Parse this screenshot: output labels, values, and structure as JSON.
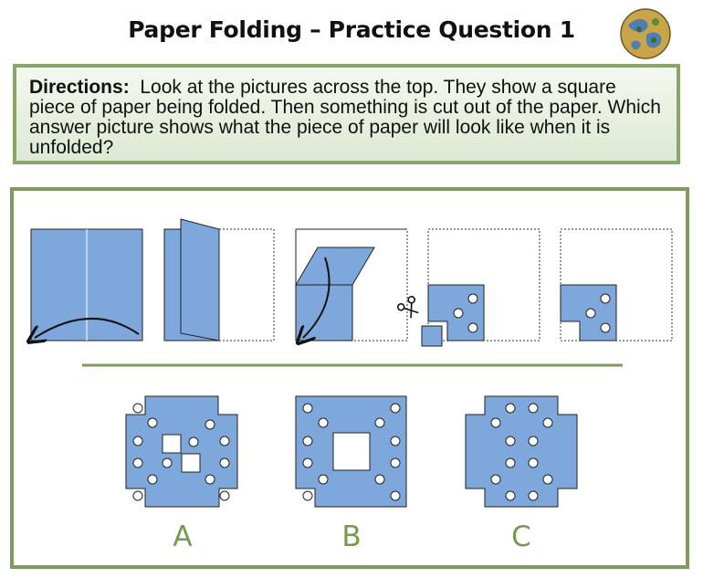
{
  "title": "Paper Folding – Practice Question 1",
  "directions": {
    "label": "Directions:",
    "text": "Look at the pictures across the top.  They show a square piece of paper being folded.  Then something is cut out of the paper.  Which answer picture shows what the piece of paper will look like when it is unfolded?"
  },
  "answers": [
    {
      "label": "A"
    },
    {
      "label": "B"
    },
    {
      "label": "C"
    }
  ],
  "colors": {
    "paper": "#7ea7dc",
    "frame": "#7e9a5e",
    "answer_label": "#759a4f",
    "directions_border": "#88a669"
  },
  "icons": [
    "globe-icon",
    "scissors-icon"
  ]
}
